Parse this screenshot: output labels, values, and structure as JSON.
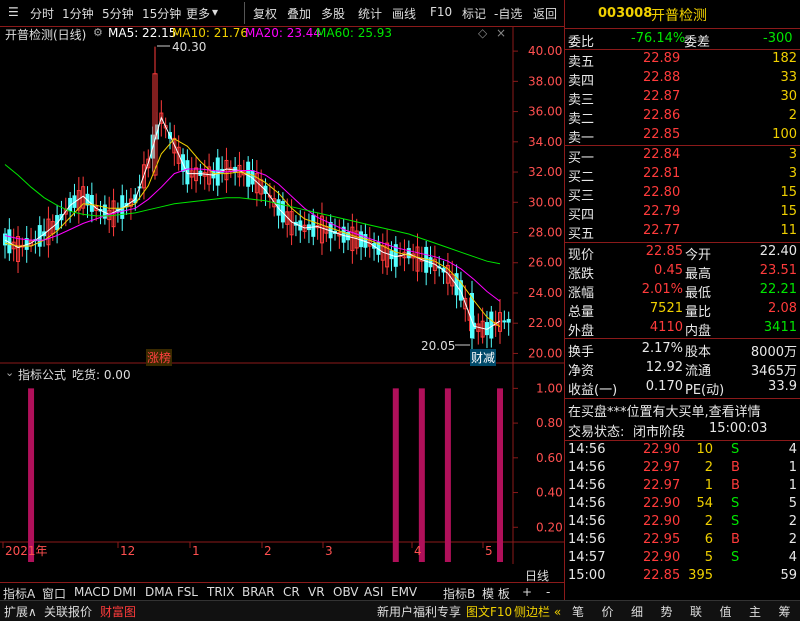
{
  "toolbar": {
    "left": [
      "分时",
      "1分钟",
      "5分钟",
      "15分钟",
      "更多"
    ],
    "right": [
      "复权",
      "叠加",
      "多股",
      "统计",
      "画线",
      "F10",
      "标记",
      "-自选",
      "返回"
    ]
  },
  "chart": {
    "stock_title": "开普检测(日线)",
    "ma_labels": [
      {
        "text": "MA5: 22.15",
        "color": "#ffffff"
      },
      {
        "text": "MA10: 21.76",
        "color": "#f0d000"
      },
      {
        "text": "MA20: 23.44",
        "color": "#ff00ff"
      },
      {
        "text": "MA60: 25.93",
        "color": "#00e600"
      }
    ],
    "high_label": "40.30",
    "low_label": "20.05",
    "badge_left": "涨榜",
    "badge_right": "财减",
    "indicator_title": "指标公式",
    "indicator_value": "吃货: 0.00",
    "x_labels": [
      "2021年",
      "12",
      "1",
      "2",
      "3",
      "4",
      "5"
    ],
    "period": "日线"
  },
  "chart_data": [
    {
      "type": "line",
      "title": "开普检测(日线)",
      "y_ticks": [
        20,
        22,
        24,
        26,
        28,
        30,
        32,
        34,
        36,
        38,
        40
      ],
      "ylim": [
        19.5,
        41
      ],
      "annotations": [
        {
          "text": "40.30"
        },
        {
          "text": "20.05"
        }
      ],
      "series": [
        {
          "name": "MA5",
          "color": "#ffffff",
          "values": [
            27.5,
            27.0,
            27.3,
            27.9,
            28.6,
            29.8,
            30.4,
            29.6,
            29.2,
            29.6,
            30.2,
            32.6,
            35.6,
            33.8,
            31.9,
            31.9,
            31.8,
            32.2,
            32.1,
            31.6,
            30.8,
            29.6,
            28.7,
            28.3,
            28.4,
            28.1,
            27.8,
            27.6,
            27.3,
            26.7,
            26.4,
            26.6,
            26.2,
            25.9,
            25.3,
            24.1,
            21.8,
            21.6,
            22.15
          ]
        },
        {
          "name": "MA10",
          "color": "#f0d000",
          "values": [
            27.3,
            27.1,
            27.1,
            27.5,
            28.1,
            29.0,
            29.9,
            29.8,
            29.6,
            29.6,
            29.9,
            31.1,
            33.2,
            34.2,
            33.7,
            32.7,
            31.9,
            31.9,
            32.0,
            31.8,
            31.3,
            30.6,
            29.6,
            28.9,
            28.6,
            28.3,
            28.0,
            27.7,
            27.5,
            27.1,
            26.7,
            26.5,
            26.3,
            26.1,
            25.6,
            24.7,
            23.5,
            22.4,
            21.76
          ]
        },
        {
          "name": "MA20",
          "color": "#ff00ff",
          "values": [
            27.8,
            27.6,
            27.5,
            27.5,
            27.8,
            28.2,
            28.6,
            28.9,
            29.2,
            29.4,
            29.6,
            30.2,
            31.0,
            31.9,
            32.2,
            32.2,
            32.1,
            32.0,
            32.1,
            32.1,
            31.8,
            31.2,
            30.4,
            29.6,
            29.0,
            28.6,
            28.2,
            27.9,
            27.6,
            27.3,
            27.0,
            26.8,
            26.6,
            26.4,
            26.1,
            25.6,
            24.9,
            24.1,
            23.44
          ]
        },
        {
          "name": "MA60",
          "color": "#00e600",
          "values": [
            32.5,
            31.8,
            31.0,
            30.3,
            29.8,
            29.4,
            29.2,
            29.1,
            29.1,
            29.2,
            29.3,
            29.5,
            29.7,
            29.9,
            30.0,
            30.1,
            30.2,
            30.3,
            30.3,
            30.2,
            30.1,
            29.9,
            29.7,
            29.5,
            29.3,
            29.1,
            28.9,
            28.7,
            28.5,
            28.3,
            28.1,
            27.9,
            27.6,
            27.3,
            27.0,
            26.7,
            26.4,
            26.1,
            25.93
          ]
        }
      ]
    },
    {
      "type": "bar",
      "title": "吃货",
      "y_ticks": [
        0.2,
        0.4,
        0.6,
        0.8,
        1.0
      ],
      "ylim": [
        0,
        1.1
      ],
      "bar_x_index": [
        2,
        30,
        32,
        34,
        38
      ],
      "values": [
        1,
        1,
        1,
        1,
        1
      ],
      "color": "#b0105a"
    }
  ],
  "axis": {
    "price_ticks": [
      "40.00",
      "38.00",
      "36.00",
      "34.00",
      "32.00",
      "30.00",
      "28.00",
      "26.00",
      "24.00",
      "22.00",
      "20.00"
    ],
    "ind_ticks": [
      "1.00",
      "0.80",
      "0.60",
      "0.40",
      "0.20"
    ]
  },
  "bottom_tabs": [
    "指标A",
    "窗口",
    "MACD",
    "DMI",
    "DMA",
    "FSL",
    "TRIX",
    "BRAR",
    "CR",
    "VR",
    "OBV",
    "ASI",
    "EMV",
    "指标B",
    "模 板",
    "+",
    "-"
  ],
  "quote": {
    "code": "003008",
    "name": "开普检测",
    "weibi_label": "委比",
    "weibi_value": "-76.14%",
    "weicha_label": "委差",
    "weicha_value": "-300",
    "asks": [
      {
        "label": "卖五",
        "price": "22.89",
        "vol": "182"
      },
      {
        "label": "卖四",
        "price": "22.88",
        "vol": "33"
      },
      {
        "label": "卖三",
        "price": "22.87",
        "vol": "30"
      },
      {
        "label": "卖二",
        "price": "22.86",
        "vol": "2"
      },
      {
        "label": "卖一",
        "price": "22.85",
        "vol": "100"
      }
    ],
    "bids": [
      {
        "label": "买一",
        "price": "22.84",
        "vol": "3"
      },
      {
        "label": "买二",
        "price": "22.81",
        "vol": "3"
      },
      {
        "label": "买三",
        "price": "22.80",
        "vol": "15"
      },
      {
        "label": "买四",
        "price": "22.79",
        "vol": "15"
      },
      {
        "label": "买五",
        "price": "22.77",
        "vol": "11"
      }
    ],
    "stats": [
      {
        "l1": "现价",
        "v1": "22.85",
        "c1": "red",
        "l2": "今开",
        "v2": "22.40",
        "c2": "wht"
      },
      {
        "l1": "涨跌",
        "v1": "0.45",
        "c1": "red",
        "l2": "最高",
        "v2": "23.51",
        "c2": "red"
      },
      {
        "l1": "涨幅",
        "v1": "2.01%",
        "c1": "red",
        "l2": "最低",
        "v2": "22.21",
        "c2": "grn"
      },
      {
        "l1": "总量",
        "v1": "7521",
        "c1": "yel",
        "l2": "量比",
        "v2": "2.08",
        "c2": "red"
      },
      {
        "l1": "外盘",
        "v1": "4110",
        "c1": "red",
        "l2": "内盘",
        "v2": "3411",
        "c2": "grn"
      }
    ],
    "stats2": [
      {
        "l1": "换手",
        "v1": "2.17%",
        "l2": "股本",
        "v2": "8000万"
      },
      {
        "l1": "净资",
        "v1": "12.92",
        "l2": "流通",
        "v2": "3465万"
      },
      {
        "l1": "收益(一)",
        "v1": "0.170",
        "l2": "PE(动)",
        "v2": "33.9"
      }
    ],
    "notice": "在买盘***位置有大买单,查看详情",
    "trade_status_label": "交易状态:",
    "trade_status": "闭市阶段",
    "trade_time": "15:00:03",
    "ticks": [
      {
        "time": "14:56",
        "price": "22.90",
        "vol": "10",
        "bs": "S",
        "num": "4"
      },
      {
        "time": "14:56",
        "price": "22.97",
        "vol": "2",
        "bs": "B",
        "num": "1"
      },
      {
        "time": "14:56",
        "price": "22.97",
        "vol": "1",
        "bs": "B",
        "num": "1"
      },
      {
        "time": "14:56",
        "price": "22.90",
        "vol": "54",
        "bs": "S",
        "num": "5"
      },
      {
        "time": "14:56",
        "price": "22.90",
        "vol": "2",
        "bs": "S",
        "num": "2"
      },
      {
        "time": "14:56",
        "price": "22.95",
        "vol": "6",
        "bs": "B",
        "num": "2"
      },
      {
        "time": "14:57",
        "price": "22.90",
        "vol": "5",
        "bs": "S",
        "num": "4"
      },
      {
        "time": "15:00",
        "price": "22.85",
        "vol": "395",
        "bs": "",
        "num": "59"
      }
    ],
    "tabs": [
      "笔",
      "价",
      "细",
      "势",
      "联",
      "值",
      "主",
      "筹"
    ]
  },
  "statusbar": {
    "expand": "扩展∧",
    "report": "关联报价",
    "fortune": "财富图",
    "promo": "新用户福利专享",
    "f10": "图文F10",
    "sidebar": "侧边栏 «"
  }
}
